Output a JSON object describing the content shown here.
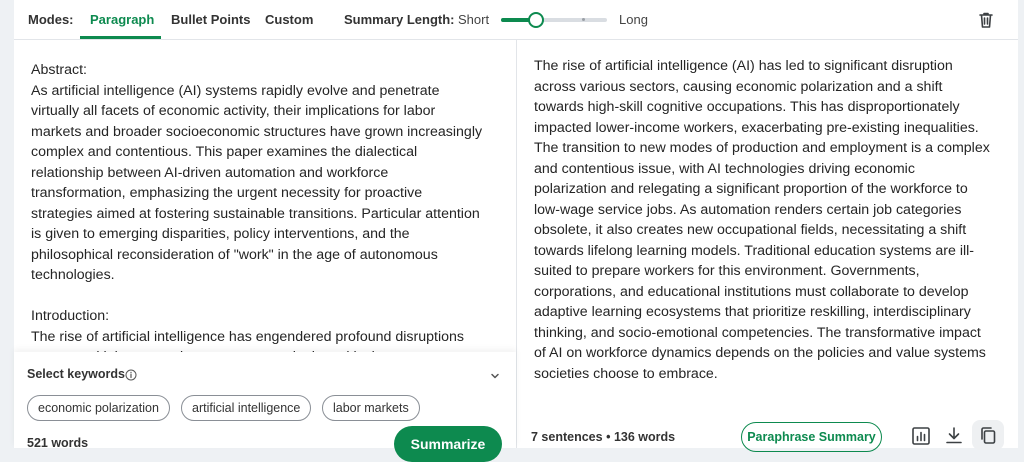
{
  "toolbar": {
    "modes_label": "Modes:",
    "tabs": [
      "Paragraph",
      "Bullet Points",
      "Custom"
    ],
    "active_tab": "Paragraph",
    "summary_length_label": "Summary Length:",
    "short_label": "Short",
    "long_label": "Long",
    "summary_length_level": 0.33,
    "icons": {
      "delete": "trash-icon"
    },
    "accent_color": "#0d8a4f"
  },
  "input": {
    "paragraphs": [
      "Abstract:\nAs artificial intelligence (AI) systems rapidly evolve and penetrate virtually all facets of economic activity, their implications for labor markets and broader socioeconomic structures have grown increasingly complex and contentious. This paper examines the dialectical relationship between AI-driven automation and workforce transformation, emphasizing the urgent necessity for proactive strategies aimed at fostering sustainable transitions. Particular attention is given to emerging disparities, policy interventions, and the philosophical reconsideration of \"work\" in the age of autonomous technologies.",
      "Introduction:\nThe rise of artificial intelligence has engendered profound disruptions across multiple economic sectors, necessitating critical"
    ]
  },
  "keywords": {
    "title": "Select keywords",
    "chips": [
      "economic polarization",
      "artificial intelligence",
      "labor markets"
    ],
    "word_count": "521 words",
    "summarize_label": "Summarize"
  },
  "output": {
    "text": "The rise of artificial intelligence (AI) has led to significant disruption across various sectors, causing economic polarization and a shift towards high-skill cognitive occupations. This has disproportionately impacted lower-income workers, exacerbating pre-existing inequalities. The transition to new modes of production and employment is a complex and contentious issue, with AI technologies driving economic polarization and relegating a significant proportion of the workforce to low-wage service jobs. As automation renders certain job categories obsolete, it also creates new occupational fields, necessitating a shift towards lifelong learning models. Traditional education systems are ill-suited to prepare workers for this environment. Governments, corporations, and educational institutions must collaborate to develop adaptive learning ecosystems that prioritize reskilling, interdisciplinary thinking, and socio-emotional competencies. The transformative impact of AI on workforce dynamics depends on the policies and value systems societies choose to embrace.",
    "sentences": "7 sentences",
    "separator": "•",
    "words": "136 words",
    "paraphrase_label": "Paraphrase Summary",
    "icons": [
      "statistics-icon",
      "download-icon",
      "copy-icon"
    ]
  }
}
